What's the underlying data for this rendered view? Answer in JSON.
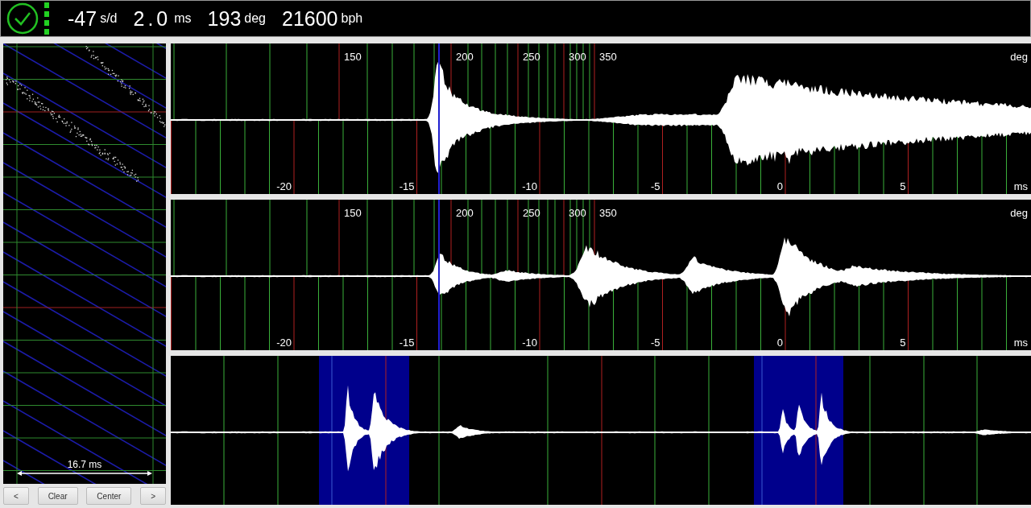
{
  "status_bar": {
    "readings": [
      {
        "value": "-47",
        "unit": "s/d"
      },
      {
        "value": "2.0",
        "unit": "ms"
      },
      {
        "value": "193",
        "unit": "deg"
      },
      {
        "value": "21600",
        "unit": "bph"
      }
    ]
  },
  "paperstrip": {
    "scale_label": "16.7 ms",
    "buttons": [
      "<",
      "Clear",
      "Center",
      ">"
    ]
  },
  "waveforms": [
    {
      "kind": "tick",
      "deg_labels": [
        "150",
        "200",
        "250",
        "300",
        "350"
      ],
      "deg_unit": "deg",
      "ms_labels": [
        "-20",
        "-15",
        "-10",
        "-5",
        "0",
        "5"
      ],
      "ms_unit": "ms"
    },
    {
      "kind": "tock",
      "deg_labels": [
        "150",
        "200",
        "250",
        "300",
        "350"
      ],
      "deg_unit": "deg",
      "ms_labels": [
        "-20",
        "-15",
        "-10",
        "-5",
        "0",
        "5"
      ],
      "ms_unit": "ms"
    },
    {
      "kind": "period"
    }
  ]
}
